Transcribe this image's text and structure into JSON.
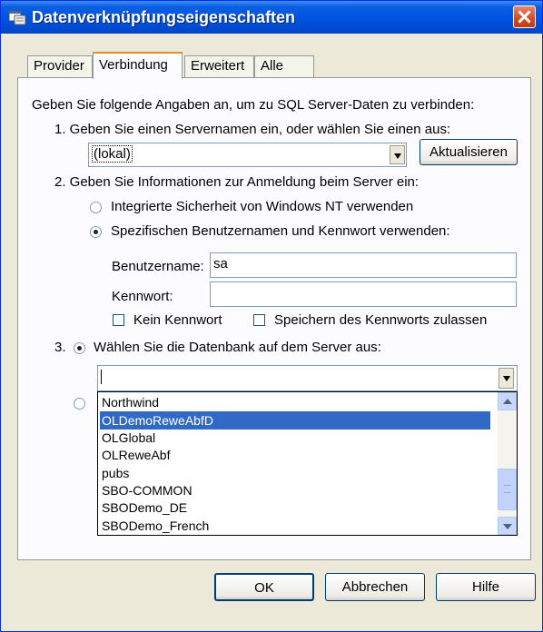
{
  "window": {
    "title": "Datenverknüpfungseigenschaften"
  },
  "tabs": [
    "Provider",
    "Verbindung",
    "Erweitert",
    "Alle"
  ],
  "active_tab": "Verbindung",
  "intro": "Geben Sie folgende Angaben an, um zu SQL Server-Daten zu verbinden:",
  "step1": {
    "label": "1. Geben Sie einen Servernamen ein, oder wählen Sie einen aus:",
    "server_value": "(lokal)",
    "refresh_button": "Aktualisieren"
  },
  "step2": {
    "label": "2. Geben Sie Informationen zur Anmeldung beim Server ein:",
    "radio_integrated": "Integrierte Sicherheit von Windows NT verwenden",
    "radio_specific": "Spezifischen Benutzernamen und Kennwort verwenden:",
    "username_label": "Benutzername:",
    "username_value": "sa",
    "password_label": "Kennwort:",
    "password_value": "",
    "no_password_label": "Kein Kennwort",
    "save_password_label": "Speichern des Kennworts zulassen"
  },
  "step3": {
    "number": "3.",
    "radio_label": "Wählen Sie die Datenbank auf dem Server aus:",
    "database_value": "",
    "options": [
      "Northwind",
      "OLDemoReweAbfD",
      "OLGlobal",
      "OLReweAbf",
      "pubs",
      "SBO-COMMON",
      "SBODemo_DE",
      "SBODemo_French"
    ],
    "selected_option": "OLDemoReweAbfD"
  },
  "buttons": {
    "ok": "OK",
    "cancel": "Abbrechen",
    "help": "Hilfe"
  },
  "colors": {
    "titlebar": "#0054e3",
    "selection": "#316ac5",
    "close_button": "#d24a25"
  }
}
